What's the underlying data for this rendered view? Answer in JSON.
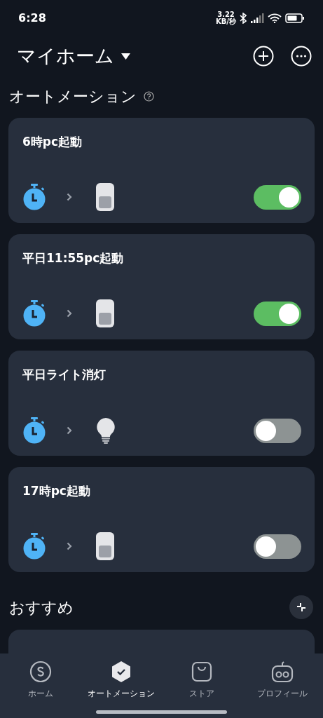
{
  "status_bar": {
    "time": "6:28",
    "net_speed": [
      "3.22",
      "KB/秒"
    ]
  },
  "header": {
    "title": "マイホーム"
  },
  "section": {
    "title": "オートメーション"
  },
  "automations": [
    {
      "name": "6時pc起動",
      "kind": "switch",
      "on": true
    },
    {
      "name": "平日11:55pc起動",
      "kind": "switch",
      "on": true
    },
    {
      "name": "平日ライト消灯",
      "kind": "bulb",
      "on": false
    },
    {
      "name": "17時pc起動",
      "kind": "switch",
      "on": false
    }
  ],
  "recommend": {
    "title": "おすすめ"
  },
  "nav": [
    {
      "label": "ホーム",
      "kind": "home",
      "selected": false
    },
    {
      "label": "オートメーション",
      "kind": "auto",
      "selected": true
    },
    {
      "label": "ストア",
      "kind": "store",
      "selected": false
    },
    {
      "label": "プロフィール",
      "kind": "profile",
      "selected": false
    }
  ]
}
